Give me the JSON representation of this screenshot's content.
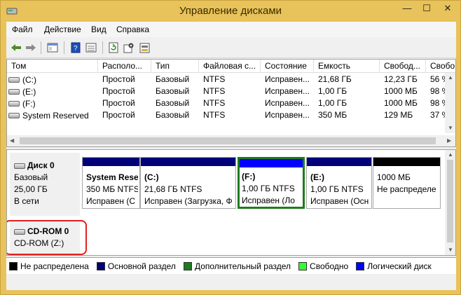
{
  "window": {
    "title": "Управление дисками",
    "min_glyph": "—",
    "max_glyph": "☐",
    "close_glyph": "✕",
    "frame_color": "#e8c25a"
  },
  "menu": [
    "Файл",
    "Действие",
    "Вид",
    "Справка"
  ],
  "volumes": {
    "columns": [
      "Том",
      "Располо...",
      "Тип",
      "Файловая с...",
      "Состояние",
      "Емкость",
      "Свобод...",
      "Свобо"
    ],
    "rows": [
      [
        "(C:)",
        "Простой",
        "Базовый",
        "NTFS",
        "Исправен...",
        "21,68 ГБ",
        "12,23 ГБ",
        "56 %"
      ],
      [
        "(E:)",
        "Простой",
        "Базовый",
        "NTFS",
        "Исправен...",
        "1,00 ГБ",
        "1000 МБ",
        "98 %"
      ],
      [
        "(F:)",
        "Простой",
        "Базовый",
        "NTFS",
        "Исправен...",
        "1,00 ГБ",
        "1000 МБ",
        "98 %"
      ],
      [
        "System Reserved",
        "Простой",
        "Базовый",
        "NTFS",
        "Исправен...",
        "350 МБ",
        "129 МБ",
        "37 %"
      ]
    ]
  },
  "disk0": {
    "name": "Диск 0",
    "type": "Базовый",
    "size": "25,00 ГБ",
    "status": "В сети",
    "partitions": [
      {
        "label": "System Rese",
        "size": "350 МБ NTFS",
        "status": "Исправен (С",
        "bar_color": "#00007a",
        "bold": true
      },
      {
        "label": "(C:)",
        "size": "21,68 ГБ NTFS",
        "status": "Исправен (Загрузка, Ф",
        "bar_color": "#00007a",
        "bold": true
      },
      {
        "label": "(F:)",
        "size": "1,00 ГБ NTFS",
        "status": "Исправен (Ло",
        "bar_color": "#0000ff",
        "bold": true
      },
      {
        "label": "(E:)",
        "size": "1,00 ГБ NTFS",
        "status": "Исправен (Осн",
        "bar_color": "#00007a",
        "bold": true
      },
      {
        "label": "",
        "size": "1000 МБ",
        "status": "Не распределе",
        "bar_color": "#000000",
        "bold": false
      }
    ]
  },
  "cdrom": {
    "name": "CD-ROM 0",
    "drive": "CD-ROM (Z:)"
  },
  "legend": [
    {
      "label": "Не распределена",
      "color": "#000000"
    },
    {
      "label": "Основной раздел",
      "color": "#00007a"
    },
    {
      "label": "Дополнительный раздел",
      "color": "#1f7a1f"
    },
    {
      "label": "Свободно",
      "color": "#33ff33"
    },
    {
      "label": "Логический диск",
      "color": "#0000ff"
    }
  ],
  "scroll": {
    "up": "▲",
    "down": "▼",
    "left": "◀",
    "right": "▶"
  }
}
